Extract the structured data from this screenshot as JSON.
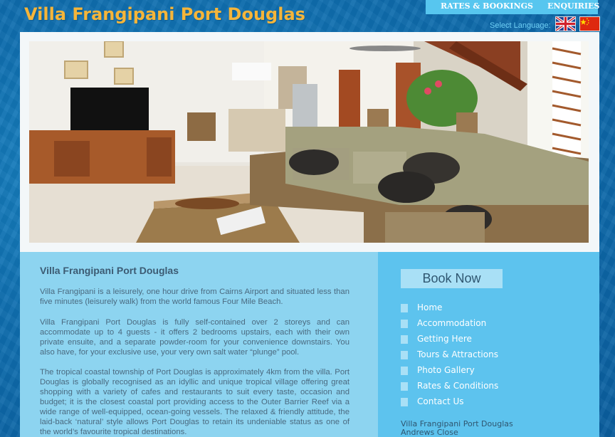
{
  "header": {
    "site_title": "Villa Frangipani Port Douglas",
    "nav": [
      "RATES & BOOKINGS",
      "ENQUIRIES"
    ],
    "select_language": "Select Language:",
    "flags": [
      "uk-flag-icon",
      "china-flag-icon"
    ]
  },
  "hero": {
    "image": "living-room-photo"
  },
  "main": {
    "title": "Villa Frangipani Port Douglas",
    "paragraphs": [
      "Villa Frangipani is a leisurely, one hour drive from Cairns Airport and situated less than five minutes (leisurely walk) from the world famous Four Mile Beach.",
      "Villa Frangipani Port Douglas is fully self-contained over 2 storeys and can accommodate up to 4 guests - it offers 2 bedrooms upstairs, each with their own private ensuite, and a separate powder-room for your convenience downstairs. You also have, for your exclusive use, your very own salt water “plunge” pool.",
      "The tropical coastal township of Port Douglas is approximately 4km from the villa. Port Douglas is globally recognised as an idyllic and unique tropical village offering great shopping with a variety of cafes and restaurants to suit every taste, occasion and budget; it is the closest coastal port providing access to the Outer Barrier Reef via a wide range of well-equipped, ocean-going vessels. The relaxed & friendly attitude, the laid-back ‘natural’ style allows Port Douglas to retain its undeniable status as one of the world’s favourite tropical destinations."
    ]
  },
  "sidebar": {
    "book_now": "Book Now",
    "menu": [
      "Home",
      "Accommodation",
      "Getting Here",
      "Tours & Attractions",
      "Photo Gallery",
      "Rates & Conditions",
      "Contact Us"
    ],
    "address": [
      "Villa Frangipani Port Douglas",
      "Andrews Close"
    ]
  },
  "colors": {
    "title_orange": "#f5b53a",
    "nav_blue": "#57c6ef",
    "content_bg": "#8dd4f0",
    "sidebar_bg": "#5dc3ee"
  }
}
